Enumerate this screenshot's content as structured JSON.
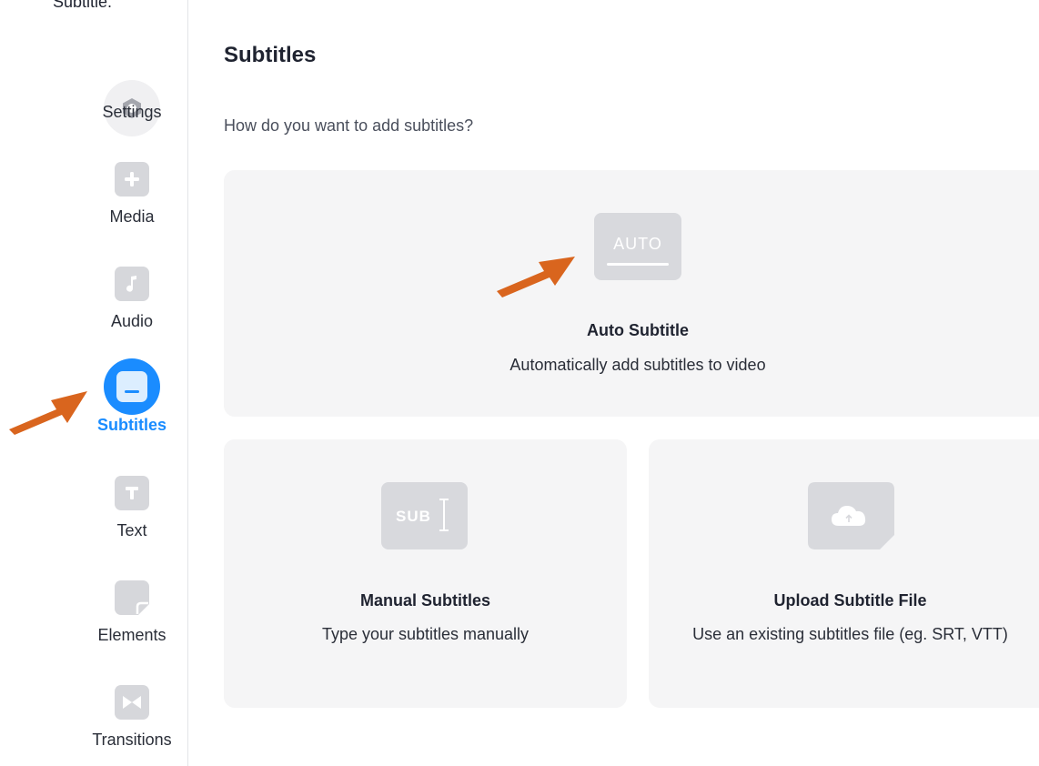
{
  "top_cut_text": "Subtitle.",
  "sidebar": {
    "items": [
      {
        "label": "Settings",
        "icon": "hexagon-settings-icon",
        "active": false
      },
      {
        "label": "Media",
        "icon": "plus-icon",
        "active": false
      },
      {
        "label": "Audio",
        "icon": "music-note-icon",
        "active": false
      },
      {
        "label": "Subtitles",
        "icon": "subtitles-icon",
        "active": true
      },
      {
        "label": "Text",
        "icon": "text-t-icon",
        "active": false
      },
      {
        "label": "Elements",
        "icon": "sticky-note-icon",
        "active": false
      },
      {
        "label": "Transitions",
        "icon": "bowtie-transition-icon",
        "active": false
      }
    ]
  },
  "main": {
    "title": "Subtitles",
    "question": "How do you want to add subtitles?",
    "cards": {
      "auto": {
        "badge": "AUTO",
        "title": "Auto Subtitle",
        "desc": "Automatically add subtitles to video"
      },
      "manual": {
        "badge": "SUB",
        "title": "Manual Subtitles",
        "desc": "Type your subtitles manually"
      },
      "upload": {
        "title": "Upload Subtitle File",
        "desc": "Use an existing subtitles file (eg. SRT, VTT)"
      }
    }
  },
  "colors": {
    "accent": "#1a8cff",
    "annotation_arrow": "#d9651e",
    "card_bg": "#f5f5f6",
    "icon_bg": "#d8d9dd"
  }
}
